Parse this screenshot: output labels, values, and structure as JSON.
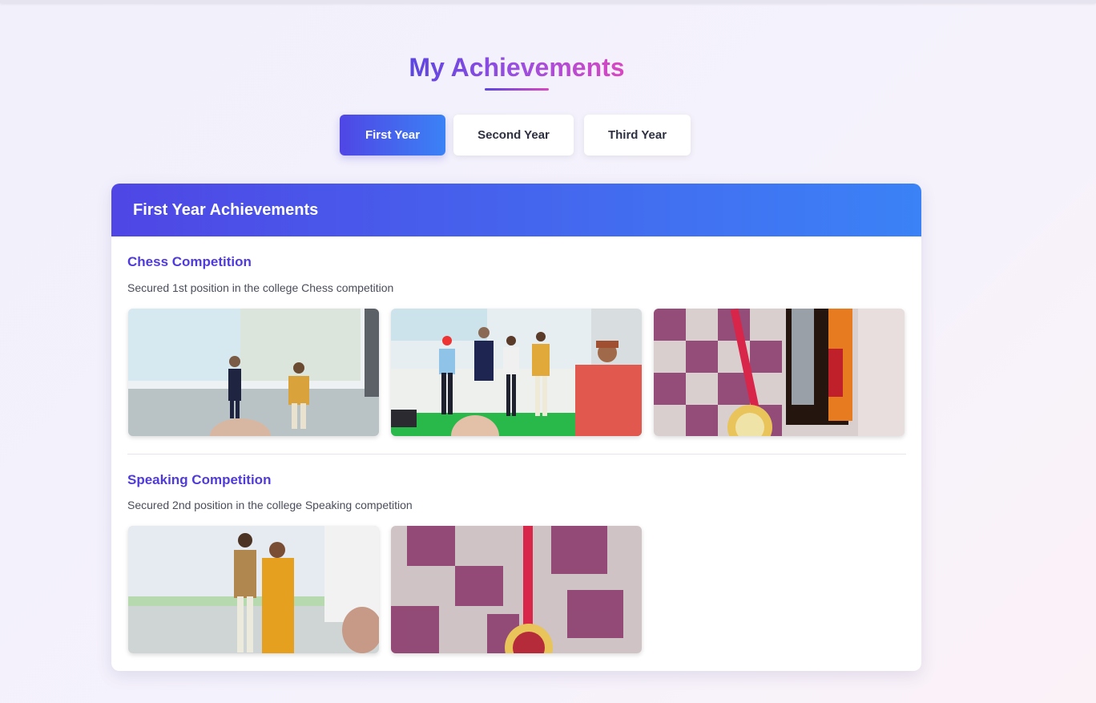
{
  "page": {
    "title": "My Achievements"
  },
  "tabs": [
    {
      "label": "First Year",
      "active": true
    },
    {
      "label": "Second Year",
      "active": false
    },
    {
      "label": "Third Year",
      "active": false
    }
  ],
  "panel": {
    "title": "First Year Achievements",
    "achievements": [
      {
        "title": "Chess Competition",
        "description": "Secured 1st position in the college Chess competition",
        "photos": [
          "stage-handshake-photo",
          "stage-group-photo",
          "medal-and-pen-photo"
        ]
      },
      {
        "title": "Speaking Competition",
        "description": "Secured 2nd position in the college Speaking competition",
        "photos": [
          "award-ceremony-photo",
          "medal-photo"
        ]
      }
    ]
  },
  "colors": {
    "accent_start": "#4f46e5",
    "accent_end": "#3b82f6",
    "title_gradient_end": "#d848c0",
    "achievement_title": "#4f3bd9"
  }
}
